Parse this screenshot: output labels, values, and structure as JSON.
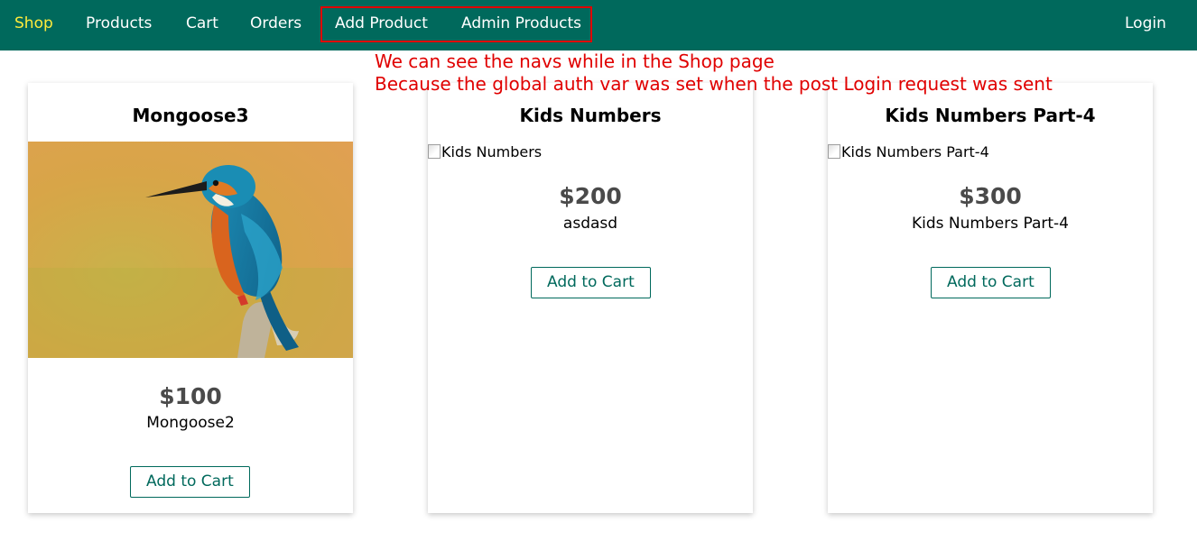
{
  "nav": {
    "shop": "Shop",
    "products": "Products",
    "cart": "Cart",
    "orders": "Orders",
    "add_product": "Add Product",
    "admin_products": "Admin Products",
    "login": "Login"
  },
  "annotation": {
    "line1": "We can see the navs while in the Shop page",
    "line2": "Because the global auth var was set when the post Login request was sent"
  },
  "products": [
    {
      "title": "Mongoose3",
      "image_alt": "",
      "price": "$100",
      "description": "Mongoose2",
      "button": "Add to Cart"
    },
    {
      "title": "Kids Numbers",
      "image_alt": "Kids Numbers",
      "price": "$200",
      "description": "asdasd",
      "button": "Add to Cart"
    },
    {
      "title": "Kids Numbers Part-4",
      "image_alt": "Kids Numbers Part-4",
      "price": "$300",
      "description": "Kids Numbers Part-4",
      "button": "Add to Cart"
    }
  ],
  "colors": {
    "header": "#00695c",
    "active_nav": "#ffeb3b",
    "annotation": "#e00000",
    "price": "#4a4a4a"
  }
}
